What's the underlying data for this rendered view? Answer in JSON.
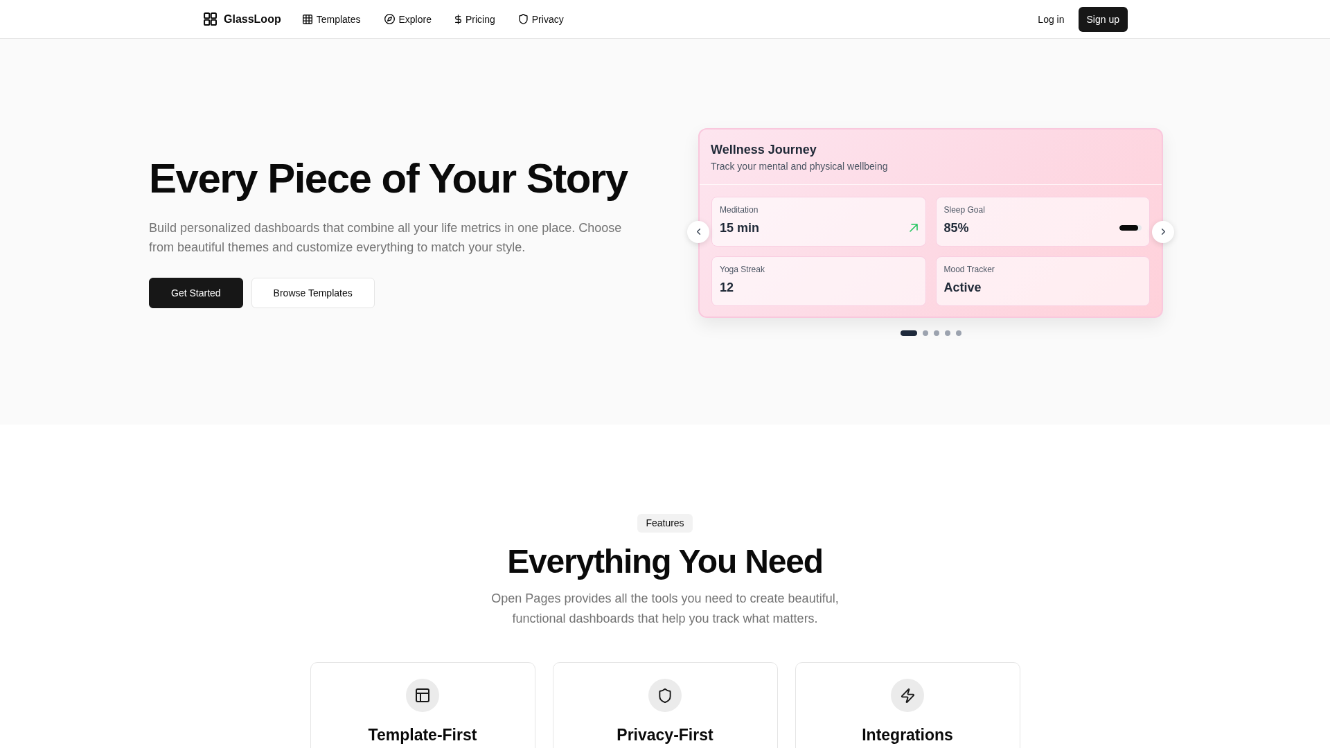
{
  "nav": {
    "logo": "GlassLoop",
    "links": [
      {
        "label": "Templates"
      },
      {
        "label": "Explore"
      },
      {
        "label": "Pricing"
      },
      {
        "label": "Privacy"
      }
    ],
    "actions": [
      {
        "label": "Log in",
        "kind": "ghost"
      },
      {
        "label": "Sign up",
        "kind": "primary"
      }
    ]
  },
  "hero": {
    "title": "Every Piece of Your Story",
    "description": "Build personalized dashboards that combine all your life metrics in one place. Choose from beautiful themes and customize everything to match your style.",
    "buttons": [
      {
        "label": "Get Started",
        "kind": "primary"
      },
      {
        "label": "Browse Templates",
        "kind": "outline"
      }
    ]
  },
  "carousel": {
    "card": {
      "title": "Wellness Journey",
      "subtitle": "Track your mental and physical wellbeing",
      "metrics": [
        {
          "label": "Meditation",
          "value": "15 min",
          "kind": "trend",
          "rising": true
        },
        {
          "label": "Sleep Goal",
          "value": "85%",
          "kind": "progress",
          "level": 0.85
        },
        {
          "label": "Yoga Streak",
          "value": "12",
          "kind": "plain"
        },
        {
          "label": "Mood Tracker",
          "value": "Active",
          "kind": "plain"
        }
      ]
    },
    "dots": [
      {
        "selected": true
      },
      {
        "selected": false
      },
      {
        "selected": false
      },
      {
        "selected": false
      },
      {
        "selected": false
      }
    ]
  },
  "features": {
    "badge": "Features",
    "title": "Everything You Need",
    "description": "Open Pages provides all the tools you need to create beautiful, functional dashboards that help you track what matters.",
    "cards": [
      {
        "title": "Template-First"
      },
      {
        "title": "Privacy-First"
      },
      {
        "title": "Integrations"
      }
    ]
  }
}
